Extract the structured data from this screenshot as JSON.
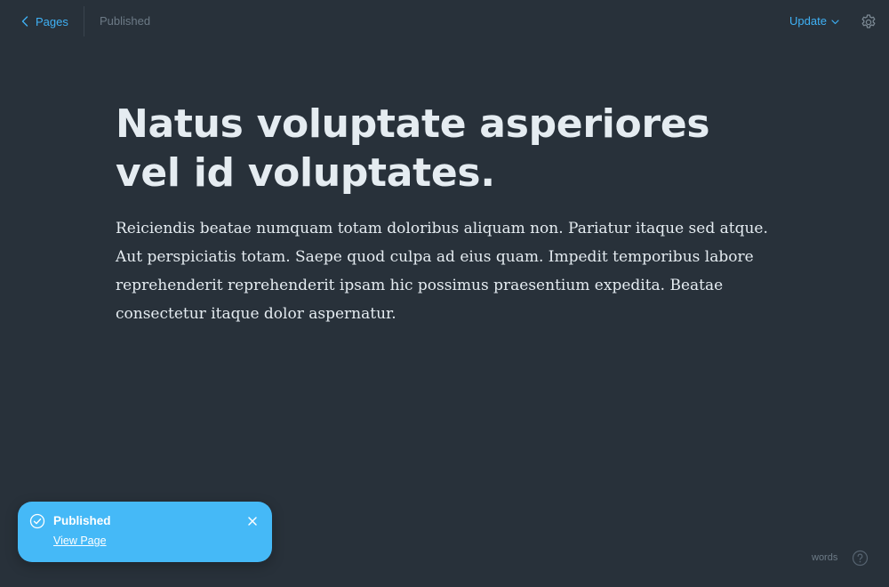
{
  "header": {
    "back_label": "Pages",
    "status": "Published",
    "update_label": "Update"
  },
  "editor": {
    "title": "Natus voluptate asperiores vel id voluptates.",
    "body": "Reiciendis beatae numquam totam doloribus aliquam non. Pariatur itaque sed atque. Aut perspiciatis totam. Saepe quod culpa ad eius quam. Impedit temporibus labore reprehenderit reprehenderit ipsam hic possimus praesentium expedita. Beatae consectetur itaque dolor aspernatur."
  },
  "toast": {
    "title": "Published",
    "link_label": "View Page"
  },
  "footer": {
    "word_count_label": "words"
  },
  "icons": {
    "back": "chevron-left-icon",
    "dropdown": "chevron-down-icon",
    "settings": "gear-icon",
    "success": "check-circle-icon",
    "close": "close-icon",
    "help": "question-circle-icon"
  },
  "colors": {
    "background": "#28313a",
    "accent": "#3fb1f5",
    "toast": "#45b9f7",
    "text": "#e5ecf1",
    "muted": "#6c7a86"
  }
}
